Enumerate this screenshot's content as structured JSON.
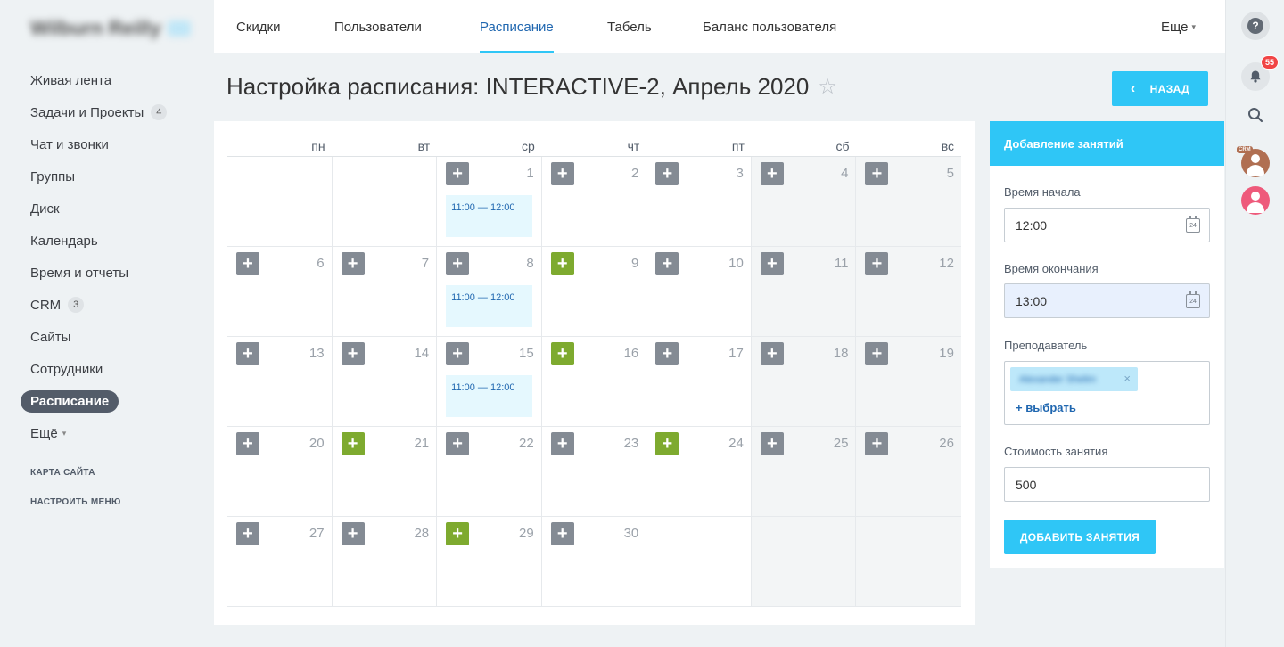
{
  "brand": {
    "name": "Wilburn Reilly"
  },
  "sidebar": {
    "items": [
      {
        "label": "Живая лента",
        "counter": ""
      },
      {
        "label": "Задачи и Проекты",
        "counter": "4"
      },
      {
        "label": "Чат и звонки",
        "counter": ""
      },
      {
        "label": "Группы",
        "counter": ""
      },
      {
        "label": "Диск",
        "counter": ""
      },
      {
        "label": "Календарь",
        "counter": ""
      },
      {
        "label": "Время и отчеты",
        "counter": ""
      },
      {
        "label": "CRM",
        "counter": "3"
      },
      {
        "label": "Сайты",
        "counter": ""
      },
      {
        "label": "Сотрудники",
        "counter": ""
      },
      {
        "label": "Расписание",
        "counter": ""
      }
    ],
    "more_label": "Ещё",
    "sitemap_label": "КАРТА САЙТА",
    "configure_label": "НАСТРОИТЬ МЕНЮ"
  },
  "right_panel": {
    "help_glyph": "?",
    "notifications_count": "55",
    "crm_tag": "CRM"
  },
  "topnav": {
    "tabs": [
      "Скидки",
      "Пользователи",
      "Расписание",
      "Табель",
      "Баланс пользователя"
    ],
    "active_tab": 2,
    "more_label": "Еще"
  },
  "page": {
    "title": "Настройка расписания: INTERACTIVE-2, Апрель 2020",
    "back_label": "НАЗАД"
  },
  "calendar": {
    "weekdays": [
      "пн",
      "вт",
      "ср",
      "чт",
      "пт",
      "сб",
      "вс"
    ],
    "weeks": [
      [
        {
          "day": ""
        },
        {
          "day": ""
        },
        {
          "day": "1",
          "plus": "gray",
          "event": "11:00 — 12:00"
        },
        {
          "day": "2",
          "plus": "gray"
        },
        {
          "day": "3",
          "plus": "gray"
        },
        {
          "day": "4",
          "plus": "gray"
        },
        {
          "day": "5",
          "plus": "gray"
        }
      ],
      [
        {
          "day": "6",
          "plus": "gray"
        },
        {
          "day": "7",
          "plus": "gray"
        },
        {
          "day": "8",
          "plus": "gray",
          "event": "11:00 — 12:00"
        },
        {
          "day": "9",
          "plus": "green"
        },
        {
          "day": "10",
          "plus": "gray"
        },
        {
          "day": "11",
          "plus": "gray"
        },
        {
          "day": "12",
          "plus": "gray"
        }
      ],
      [
        {
          "day": "13",
          "plus": "gray"
        },
        {
          "day": "14",
          "plus": "gray"
        },
        {
          "day": "15",
          "plus": "gray",
          "event": "11:00 — 12:00"
        },
        {
          "day": "16",
          "plus": "green"
        },
        {
          "day": "17",
          "plus": "gray"
        },
        {
          "day": "18",
          "plus": "gray"
        },
        {
          "day": "19",
          "plus": "gray"
        }
      ],
      [
        {
          "day": "20",
          "plus": "gray"
        },
        {
          "day": "21",
          "plus": "green"
        },
        {
          "day": "22",
          "plus": "gray"
        },
        {
          "day": "23",
          "plus": "gray"
        },
        {
          "day": "24",
          "plus": "green"
        },
        {
          "day": "25",
          "plus": "gray"
        },
        {
          "day": "26",
          "plus": "gray"
        }
      ],
      [
        {
          "day": "27",
          "plus": "gray"
        },
        {
          "day": "28",
          "plus": "gray"
        },
        {
          "day": "29",
          "plus": "green"
        },
        {
          "day": "30",
          "plus": "gray"
        },
        {
          "day": ""
        },
        {
          "day": ""
        },
        {
          "day": ""
        }
      ]
    ]
  },
  "form": {
    "header": "Добавление занятий",
    "start_label": "Время начала",
    "start_value": "12:00",
    "end_label": "Время окончания",
    "end_value": "13:00",
    "teacher_label": "Преподаватель",
    "teacher_name": "Alexander Shelim",
    "teacher_remove": "×",
    "pick_label": "+ выбрать",
    "price_label": "Стоимость занятия",
    "price_value": "500",
    "submit_label": "ДОБАВИТЬ ЗАНЯТИЯ",
    "calendar_icon_text": "24"
  },
  "colors": {
    "accent": "#2fc6f6",
    "link": "#2067b0",
    "plus_gray": "#848b94",
    "plus_green": "#7eaa2f"
  }
}
